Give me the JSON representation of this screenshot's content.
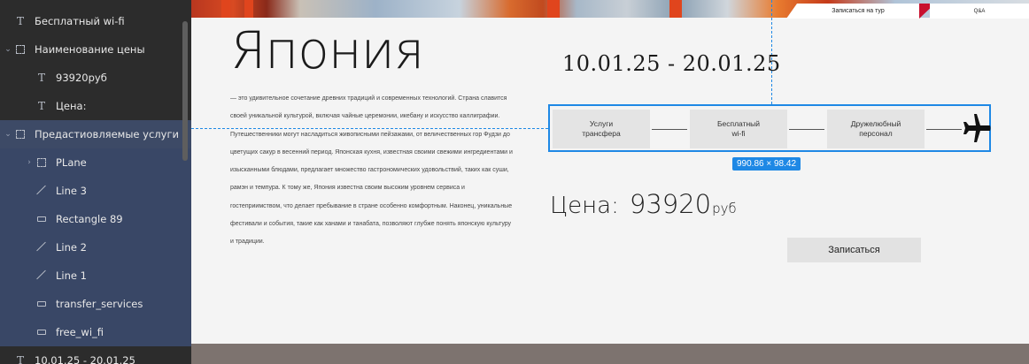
{
  "layers": [
    {
      "label": "Бесплатный wi-fi",
      "icon": "text",
      "indent": 0,
      "chevron": "",
      "style": ""
    },
    {
      "label": "Наименование цены",
      "icon": "frame",
      "indent": 0,
      "chevron": "⌄",
      "style": ""
    },
    {
      "label": "93920руб",
      "icon": "text",
      "indent": 1,
      "chevron": "",
      "style": ""
    },
    {
      "label": "Цена:",
      "icon": "text",
      "indent": 1,
      "chevron": "",
      "style": ""
    },
    {
      "label": "Предастиовляемые услуги",
      "icon": "frame",
      "indent": 0,
      "chevron": "⌄",
      "style": "selected"
    },
    {
      "label": "PLane",
      "icon": "frame",
      "indent": 1,
      "chevron": "›",
      "style": "child"
    },
    {
      "label": "Line 3",
      "icon": "line",
      "indent": 1,
      "chevron": "",
      "style": "child"
    },
    {
      "label": "Rectangle 89",
      "icon": "rect",
      "indent": 1,
      "chevron": "",
      "style": "child"
    },
    {
      "label": "Line 2",
      "icon": "line",
      "indent": 1,
      "chevron": "",
      "style": "child"
    },
    {
      "label": "Line 1",
      "icon": "line",
      "indent": 1,
      "chevron": "",
      "style": "child"
    },
    {
      "label": "transfer_services",
      "icon": "rect",
      "indent": 1,
      "chevron": "",
      "style": "child"
    },
    {
      "label": "free_wi_fi",
      "icon": "rect",
      "indent": 1,
      "chevron": "",
      "style": "child"
    },
    {
      "label": "10.01.25 - 20.01.25",
      "icon": "text",
      "indent": 0,
      "chevron": "",
      "style": ""
    }
  ],
  "nav": {
    "tour_tab": "Записаться на тур",
    "qa_tab": "Q&A"
  },
  "page": {
    "title": "Япония",
    "dates": "10.01.25 - 20.01.25",
    "description": "— это удивительное сочетание древних традиций и современных технологий. Страна славится своей уникальной культурой, включая чайные церемонии, икебану и искусство каллиграфии. Путешественники могут насладиться живописными пейзажами, от величественных гор Фудзи до цветущих сакур в весенний период. Японская кухня, известная своими свежими ингредиентами и изысканными блюдами, предлагает множество гастрономических удовольствий, таких как суши, рамэн и темпура. К тому же, Япония известна своим высоким уровнем сервиса и гостеприимством, что делает пребывание в стране особенно комфортным. Наконец, уникальные фестивали и события, такие как ханами и танабата, позволяют глубже понять японскую культуру и традиции.",
    "services": [
      {
        "line1": "Услуги",
        "line2": "трансфера"
      },
      {
        "line1": "Бесплатный",
        "line2": "wi-fi"
      },
      {
        "line1": "Дружелюбный",
        "line2": "персонал"
      }
    ],
    "selection_size": "990.86 × 98.42",
    "price_label": "Цена:",
    "price_value": "93920",
    "price_currency": "руб",
    "book_button": "Записаться"
  },
  "colors": {
    "selection": "#1e88e5",
    "accent_red": "#c8102e",
    "panel": "#2c2c2c",
    "panel_selected": "#3d4a66"
  },
  "icons": {
    "plane": "airplane-icon"
  }
}
